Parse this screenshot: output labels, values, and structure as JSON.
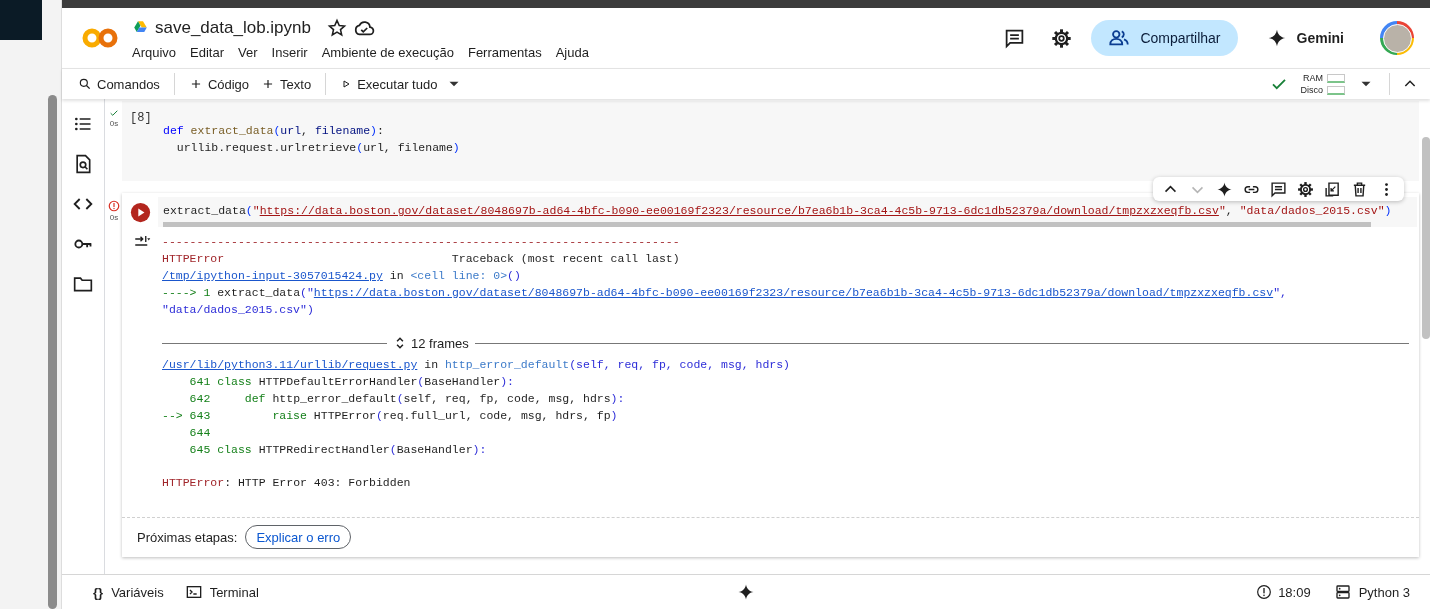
{
  "header": {
    "title": "save_data_lob.ipynb",
    "menu": [
      "Arquivo",
      "Editar",
      "Ver",
      "Inserir",
      "Ambiente de execução",
      "Ferramentas",
      "Ajuda"
    ],
    "share_button": "Compartilhar",
    "gemini_button": "Gemini"
  },
  "toolbar": {
    "commands": "Comandos",
    "add_code": "Código",
    "add_text": "Texto",
    "run_all": "Executar tudo",
    "ram_label": "RAM",
    "disk_label": "Disco"
  },
  "cells": [
    {
      "failed": false,
      "time": "0s",
      "execution_count": "[8]",
      "lines": [
        [
          {
            "kind": "keyword",
            "text": "def"
          },
          {
            "kind": "function",
            "text": " extract_data"
          },
          {
            "kind": "paren",
            "text": "("
          },
          {
            "kind": "param",
            "text": "url"
          },
          {
            "kind": "plain",
            "text": ", "
          },
          {
            "kind": "param",
            "text": "filename"
          },
          {
            "kind": "paren",
            "text": ")"
          },
          {
            "kind": "plain",
            "text": ":"
          }
        ],
        [
          {
            "kind": "plain",
            "text": "  urllib.request.urlretrieve"
          },
          {
            "kind": "paren",
            "text": "("
          },
          {
            "kind": "plain",
            "text": "url, filename"
          },
          {
            "kind": "paren",
            "text": ")"
          }
        ]
      ]
    },
    {
      "failed": true,
      "time": "0s",
      "cell_toolbar": [
        {
          "disabled": false
        },
        {
          "disabled": true
        },
        {
          "disabled": false
        },
        {
          "disabled": false
        },
        {
          "disabled": false
        },
        {
          "disabled": false
        },
        {
          "disabled": false
        },
        {
          "disabled": false
        },
        {
          "disabled": false
        }
      ],
      "lines": [
        [
          {
            "kind": "plain",
            "text": "extract_data"
          },
          {
            "kind": "paren",
            "text": "("
          },
          {
            "kind": "string",
            "text": "\""
          },
          {
            "kind": "string_link",
            "text": "https://data.boston.gov/dataset/8048697b-ad64-4bfc-b090-ee00169f2323/resource/b7ea6b1b-3ca4-4c5b-9713-6dc1db52379a/download/tmpzxzxeqfb.csv"
          },
          {
            "kind": "string",
            "text": "\""
          },
          {
            "kind": "plain",
            "text": ", "
          },
          {
            "kind": "string",
            "text": "\"data/dados_2015.csv\""
          },
          {
            "kind": "paren",
            "text": ")"
          }
        ]
      ],
      "output": [
        {
          "kind": "code",
          "lines": [
            [
              {
                "kind": "error",
                "text": "---------------------------------------------------------------------------"
              }
            ],
            [
              {
                "kind": "error",
                "text": "HTTPError"
              },
              {
                "kind": "plain",
                "text": "                                 Traceback (most recent call last)"
              }
            ],
            [
              {
                "kind": "link",
                "text": "/tmp/ipython-input-3057015424.py"
              },
              {
                "kind": "plain",
                "text": " in "
              },
              {
                "kind": "ref",
                "text": "<cell line: 0>"
              },
              {
                "kind": "blue",
                "text": "()"
              }
            ],
            [
              {
                "kind": "green",
                "text": "----> 1 "
              },
              {
                "kind": "plain",
                "text": "extract_data"
              },
              {
                "kind": "blue",
                "text": "(\""
              },
              {
                "kind": "link",
                "text": "https://data.boston.gov/dataset/8048697b-ad64-4bfc-b090-ee00169f2323/resource/b7ea6b1b-3ca4-4c5b-9713-6dc1db52379a/download/tmpzxzxeqfb.csv"
              },
              {
                "kind": "blue",
                "text": "\","
              }
            ],
            [
              {
                "kind": "blue",
                "text": "\"data/dados_2015.csv\")"
              }
            ]
          ]
        },
        {
          "kind": "frames",
          "label": "12 frames"
        },
        {
          "kind": "code",
          "lines": [
            [
              {
                "kind": "link",
                "text": "/usr/lib/python3.11/urllib/request.py"
              },
              {
                "kind": "plain",
                "text": " in "
              },
              {
                "kind": "ref",
                "text": "http_error_default"
              },
              {
                "kind": "blue",
                "text": "(self, req, fp, code, msg, hdrs)"
              }
            ],
            [
              {
                "kind": "green",
                "text": "    641 class "
              },
              {
                "kind": "plain",
                "text": "HTTPDefaultErrorHandler"
              },
              {
                "kind": "blue",
                "text": "("
              },
              {
                "kind": "plain",
                "text": "BaseHandler"
              },
              {
                "kind": "blue",
                "text": "):"
              }
            ],
            [
              {
                "kind": "green",
                "text": "    642     def "
              },
              {
                "kind": "plain",
                "text": "http_error_default"
              },
              {
                "kind": "blue",
                "text": "("
              },
              {
                "kind": "plain",
                "text": "self, req, fp, code, msg, hdrs"
              },
              {
                "kind": "blue",
                "text": "):"
              }
            ],
            [
              {
                "kind": "green",
                "text": "--> 643         raise "
              },
              {
                "kind": "plain",
                "text": "HTTPError"
              },
              {
                "kind": "blue",
                "text": "("
              },
              {
                "kind": "plain",
                "text": "req.full_url, code, msg, hdrs, fp"
              },
              {
                "kind": "blue",
                "text": ")"
              }
            ],
            [
              {
                "kind": "green",
                "text": "    644"
              }
            ],
            [
              {
                "kind": "green",
                "text": "    645 class "
              },
              {
                "kind": "plain",
                "text": "HTTPRedirectHandler"
              },
              {
                "kind": "blue",
                "text": "("
              },
              {
                "kind": "plain",
                "text": "BaseHandler"
              },
              {
                "kind": "blue",
                "text": "):"
              }
            ]
          ]
        },
        {
          "kind": "code",
          "lines": [
            [
              {
                "kind": "error",
                "text": "HTTPError"
              },
              {
                "kind": "plain",
                "text": ": HTTP Error 403: Forbidden"
              }
            ]
          ]
        }
      ],
      "next_steps": {
        "label": "Próximas etapas:",
        "button": "Explicar o erro"
      }
    }
  ],
  "status_bar": {
    "variables_icon": "{}",
    "variables": "Variáveis",
    "terminal": "Terminal",
    "time": "18:09",
    "runtime": "Python 3"
  }
}
